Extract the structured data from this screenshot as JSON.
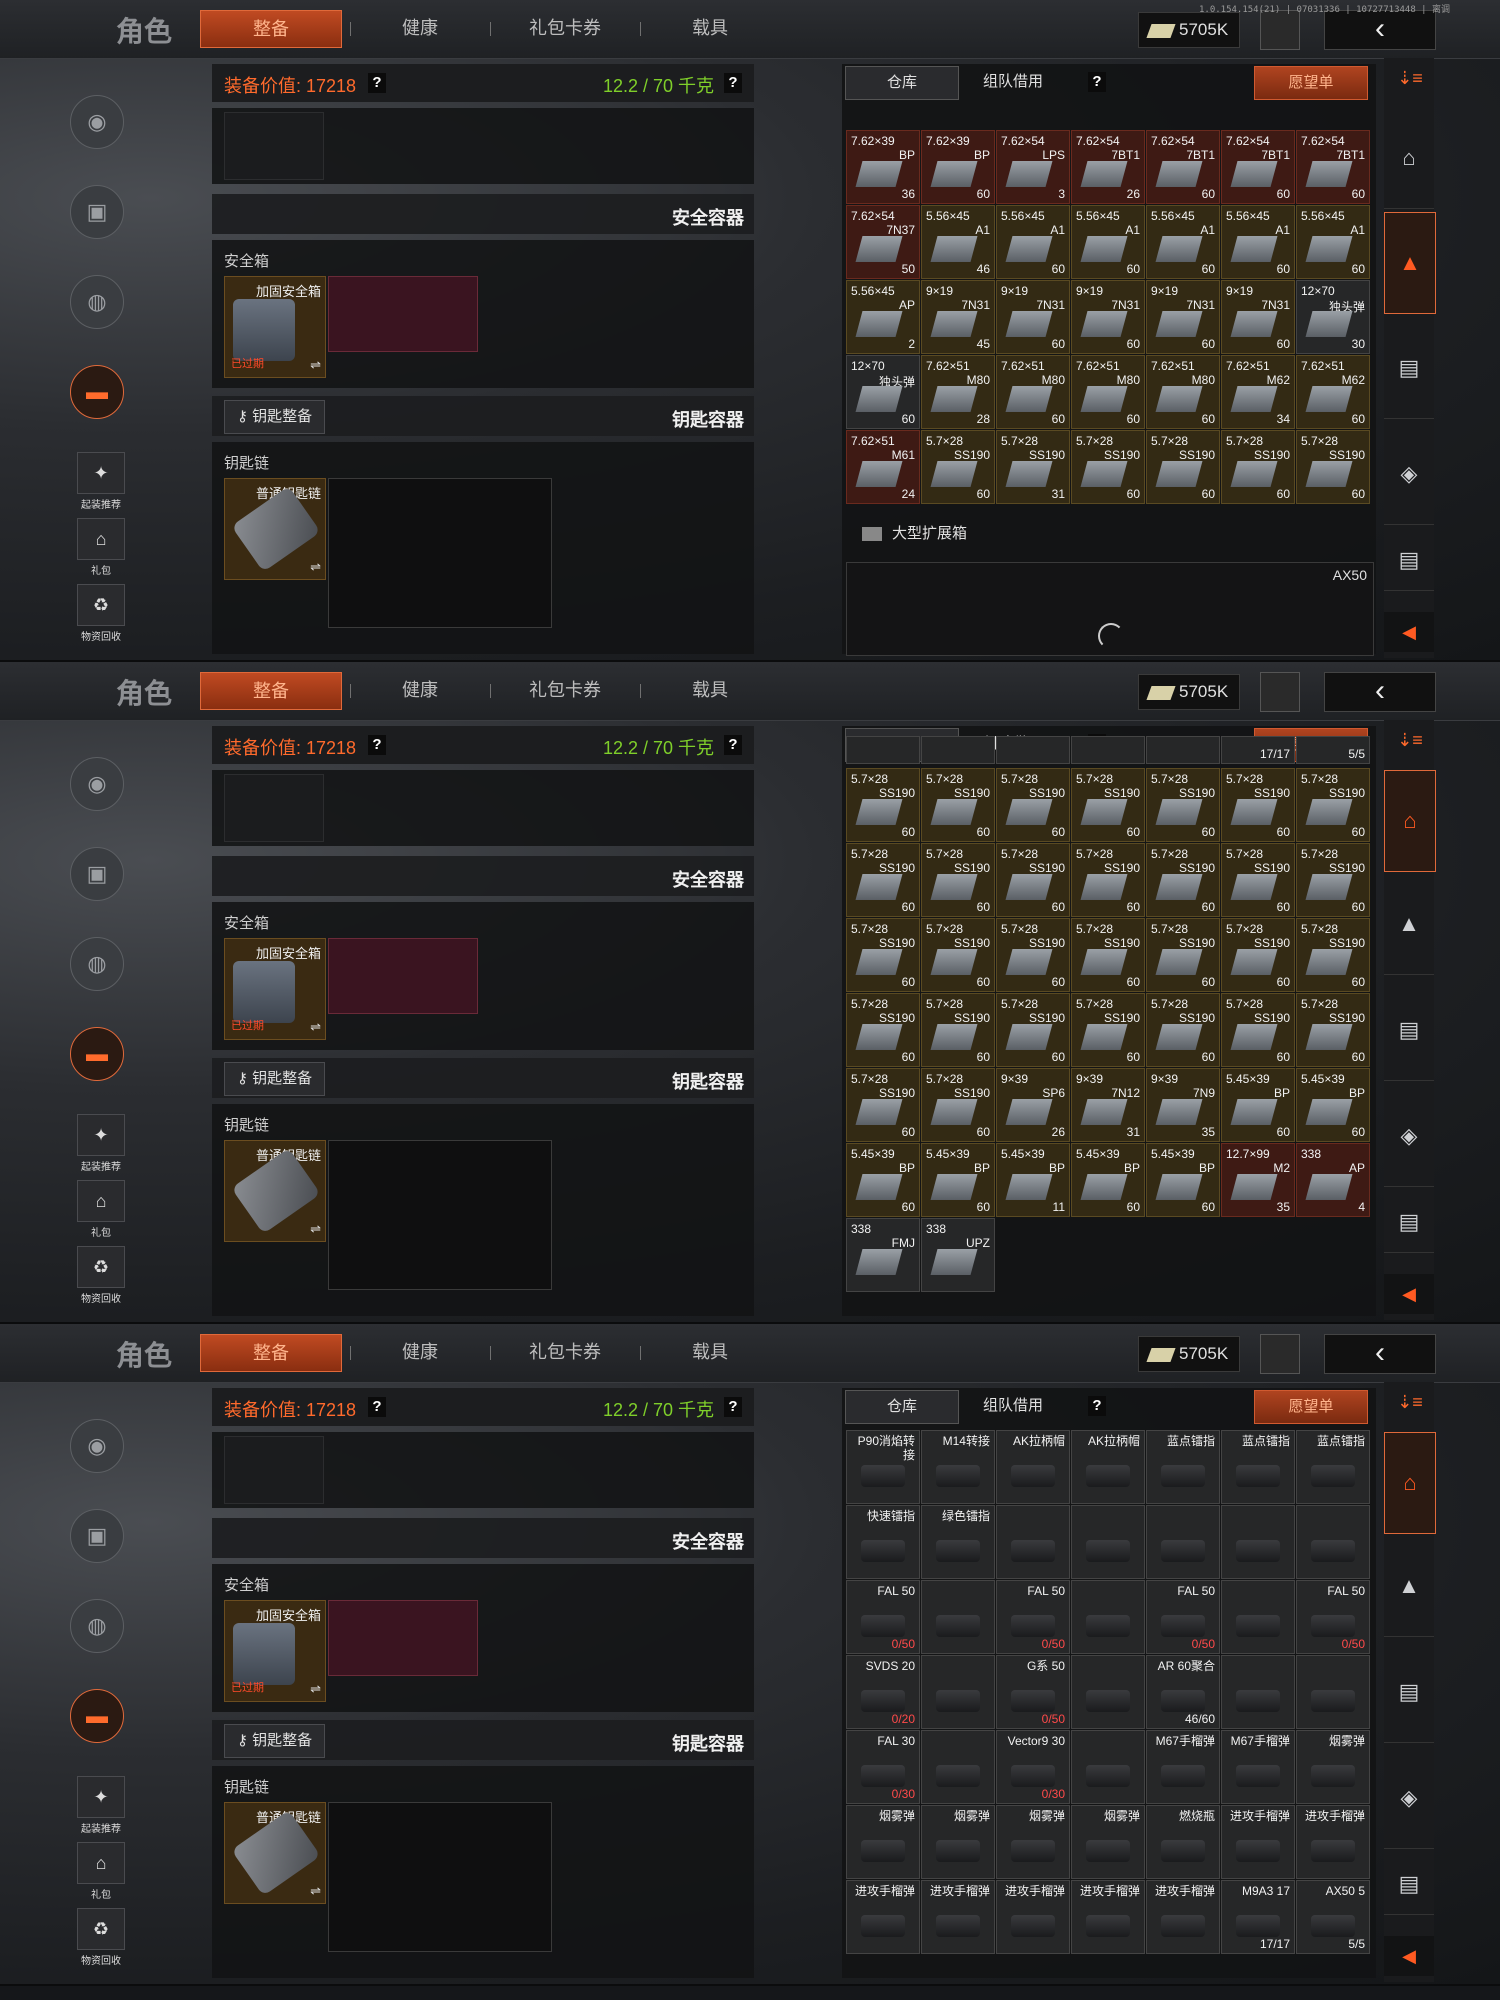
{
  "colors": {
    "accent": "#e0693a",
    "value": "#ff6a2c",
    "weight": "#7fcf2a"
  },
  "version": "1.0.154.154(21) | 07031336 | 10727713448 | 离调",
  "header": {
    "role": "角色",
    "tabs": [
      "整备",
      "健康",
      "礼包卡券",
      "载具"
    ],
    "money": "5705K"
  },
  "left_nav": {
    "buttons": [
      "起装推荐",
      "礼包",
      "物资回收"
    ]
  },
  "equip": {
    "value_label": "装备价值: 17218",
    "weight_label": "12.2 / 70 千克",
    "help": "?"
  },
  "safe": {
    "header": "安全容器",
    "section": "安全箱",
    "item": "加固安全箱",
    "expired": "已过期"
  },
  "key": {
    "button": "钥匙整备",
    "header": "钥匙容器",
    "section": "钥匙链",
    "item": "普通钥匙链"
  },
  "storage": {
    "tab_warehouse": "仓库",
    "tab_team": "组队借用",
    "help": "?",
    "wishlist": "愿望单",
    "expand_label": "大型扩展箱",
    "container": "AX50"
  },
  "screen1_cells": [
    [
      "7.62×39",
      "BP",
      "36",
      "red"
    ],
    [
      "7.62×39",
      "BP",
      "60",
      "red"
    ],
    [
      "7.62×54",
      "LPS",
      "3",
      "red"
    ],
    [
      "7.62×54",
      "7BT1",
      "26",
      "red"
    ],
    [
      "7.62×54",
      "7BT1",
      "60",
      "red"
    ],
    [
      "7.62×54",
      "7BT1",
      "60",
      "red"
    ],
    [
      "7.62×54",
      "7BT1",
      "60",
      "red"
    ],
    [
      "7.62×54",
      "7N37",
      "50",
      "red"
    ],
    [
      "5.56×45",
      "A1",
      "46",
      ""
    ],
    [
      "5.56×45",
      "A1",
      "60",
      ""
    ],
    [
      "5.56×45",
      "A1",
      "60",
      ""
    ],
    [
      "5.56×45",
      "A1",
      "60",
      ""
    ],
    [
      "5.56×45",
      "A1",
      "60",
      ""
    ],
    [
      "5.56×45",
      "A1",
      "60",
      ""
    ],
    [
      "5.56×45",
      "AP",
      "2",
      ""
    ],
    [
      "9×19",
      "7N31",
      "45",
      ""
    ],
    [
      "9×19",
      "7N31",
      "60",
      ""
    ],
    [
      "9×19",
      "7N31",
      "60",
      ""
    ],
    [
      "9×19",
      "7N31",
      "60",
      ""
    ],
    [
      "9×19",
      "7N31",
      "60",
      ""
    ],
    [
      "12×70",
      "独头弹",
      "30",
      "gray"
    ],
    [
      "12×70",
      "独头弹",
      "60",
      "gray"
    ],
    [
      "7.62×51",
      "M80",
      "28",
      ""
    ],
    [
      "7.62×51",
      "M80",
      "60",
      ""
    ],
    [
      "7.62×51",
      "M80",
      "60",
      ""
    ],
    [
      "7.62×51",
      "M80",
      "60",
      ""
    ],
    [
      "7.62×51",
      "M62",
      "34",
      ""
    ],
    [
      "7.62×51",
      "M62",
      "60",
      ""
    ],
    [
      "7.62×51",
      "M61",
      "24",
      "red"
    ],
    [
      "5.7×28",
      "SS190",
      "60",
      ""
    ],
    [
      "5.7×28",
      "SS190",
      "31",
      ""
    ],
    [
      "5.7×28",
      "SS190",
      "60",
      ""
    ],
    [
      "5.7×28",
      "SS190",
      "60",
      ""
    ],
    [
      "5.7×28",
      "SS190",
      "60",
      ""
    ],
    [
      "5.7×28",
      "SS190",
      "60",
      ""
    ]
  ],
  "screen2_top": [
    "",
    "",
    "",
    "",
    "",
    "17/17",
    "5/5"
  ],
  "screen2_cells": [
    [
      "5.7×28",
      "SS190",
      "60",
      ""
    ],
    [
      "5.7×28",
      "SS190",
      "60",
      ""
    ],
    [
      "5.7×28",
      "SS190",
      "60",
      ""
    ],
    [
      "5.7×28",
      "SS190",
      "60",
      ""
    ],
    [
      "5.7×28",
      "SS190",
      "60",
      ""
    ],
    [
      "5.7×28",
      "SS190",
      "60",
      ""
    ],
    [
      "5.7×28",
      "SS190",
      "60",
      ""
    ],
    [
      "5.7×28",
      "SS190",
      "60",
      ""
    ],
    [
      "5.7×28",
      "SS190",
      "60",
      ""
    ],
    [
      "5.7×28",
      "SS190",
      "60",
      ""
    ],
    [
      "5.7×28",
      "SS190",
      "60",
      ""
    ],
    [
      "5.7×28",
      "SS190",
      "60",
      ""
    ],
    [
      "5.7×28",
      "SS190",
      "60",
      ""
    ],
    [
      "5.7×28",
      "SS190",
      "60",
      ""
    ],
    [
      "5.7×28",
      "SS190",
      "60",
      ""
    ],
    [
      "5.7×28",
      "SS190",
      "60",
      ""
    ],
    [
      "5.7×28",
      "SS190",
      "60",
      ""
    ],
    [
      "5.7×28",
      "SS190",
      "60",
      ""
    ],
    [
      "5.7×28",
      "SS190",
      "60",
      ""
    ],
    [
      "5.7×28",
      "SS190",
      "60",
      ""
    ],
    [
      "5.7×28",
      "SS190",
      "60",
      ""
    ],
    [
      "5.7×28",
      "SS190",
      "60",
      ""
    ],
    [
      "5.7×28",
      "SS190",
      "60",
      ""
    ],
    [
      "5.7×28",
      "SS190",
      "60",
      ""
    ],
    [
      "5.7×28",
      "SS190",
      "60",
      ""
    ],
    [
      "5.7×28",
      "SS190",
      "60",
      ""
    ],
    [
      "5.7×28",
      "SS190",
      "60",
      ""
    ],
    [
      "5.7×28",
      "SS190",
      "60",
      ""
    ],
    [
      "5.7×28",
      "SS190",
      "60",
      ""
    ],
    [
      "5.7×28",
      "SS190",
      "60",
      ""
    ],
    [
      "9×39",
      "SP6",
      "26",
      ""
    ],
    [
      "9×39",
      "7N12",
      "31",
      ""
    ],
    [
      "9×39",
      "7N9",
      "35",
      ""
    ],
    [
      "5.45×39",
      "BP",
      "60",
      ""
    ],
    [
      "5.45×39",
      "BP",
      "60",
      ""
    ],
    [
      "5.45×39",
      "BP",
      "60",
      ""
    ],
    [
      "5.45×39",
      "BP",
      "60",
      ""
    ],
    [
      "5.45×39",
      "BP",
      "11",
      ""
    ],
    [
      "5.45×39",
      "BP",
      "60",
      ""
    ],
    [
      "5.45×39",
      "BP",
      "60",
      ""
    ],
    [
      "12.7×99",
      "M2",
      "35",
      "red"
    ],
    [
      "338",
      "AP",
      "4",
      "red"
    ],
    [
      "338",
      "FMJ",
      "",
      "gray"
    ],
    [
      "338",
      "UPZ",
      "",
      "gray"
    ]
  ],
  "screen3_cells": [
    [
      "P90消焰转接",
      "",
      ""
    ],
    [
      "M14转接",
      "",
      ""
    ],
    [
      "AK拉柄帽",
      "",
      ""
    ],
    [
      "AK拉柄帽",
      "",
      ""
    ],
    [
      "蓝点镭指",
      "",
      ""
    ],
    [
      "蓝点镭指",
      "",
      ""
    ],
    [
      "蓝点镭指",
      "",
      ""
    ],
    [
      "快速镭指",
      "",
      ""
    ],
    [
      "绿色镭指",
      "",
      ""
    ],
    [
      "",
      "",
      ""
    ],
    [
      "",
      "",
      ""
    ],
    [
      "",
      "",
      ""
    ],
    [
      "",
      "",
      ""
    ],
    [
      "",
      "",
      ""
    ],
    [
      "FAL 50",
      "0/50",
      "low"
    ],
    [
      "",
      "",
      ""
    ],
    [
      "FAL 50",
      "0/50",
      "low"
    ],
    [
      "",
      "",
      ""
    ],
    [
      "FAL 50",
      "0/50",
      "low"
    ],
    [
      "",
      "",
      ""
    ],
    [
      "FAL 50",
      "0/50",
      "low"
    ],
    [
      "SVDS 20",
      "0/20",
      "low"
    ],
    [
      "",
      "",
      ""
    ],
    [
      "G系 50",
      "0/50",
      "low"
    ],
    [
      "",
      "",
      ""
    ],
    [
      "AR 60聚合",
      "46/60",
      ""
    ],
    [
      "",
      "",
      ""
    ],
    [
      "",
      "",
      ""
    ],
    [
      "FAL 30",
      "0/30",
      "low"
    ],
    [
      "",
      "",
      ""
    ],
    [
      "Vector9 30",
      "0/30",
      "low"
    ],
    [
      "",
      "",
      ""
    ],
    [
      "M67手榴弹",
      "",
      ""
    ],
    [
      "M67手榴弹",
      "",
      ""
    ],
    [
      "烟雾弹",
      "",
      ""
    ],
    [
      "烟雾弹",
      "",
      ""
    ],
    [
      "烟雾弹",
      "",
      ""
    ],
    [
      "烟雾弹",
      "",
      ""
    ],
    [
      "烟雾弹",
      "",
      ""
    ],
    [
      "燃烧瓶",
      "",
      ""
    ],
    [
      "进攻手榴弹",
      "",
      ""
    ],
    [
      "进攻手榴弹",
      "",
      ""
    ],
    [
      "进攻手榴弹",
      "",
      ""
    ],
    [
      "进攻手榴弹",
      "",
      ""
    ],
    [
      "进攻手榴弹",
      "",
      ""
    ],
    [
      "进攻手榴弹",
      "",
      ""
    ],
    [
      "进攻手榴弹",
      "",
      ""
    ],
    [
      "M9A3 17",
      "17/17",
      ""
    ],
    [
      "AX50 5",
      "5/5",
      ""
    ]
  ]
}
